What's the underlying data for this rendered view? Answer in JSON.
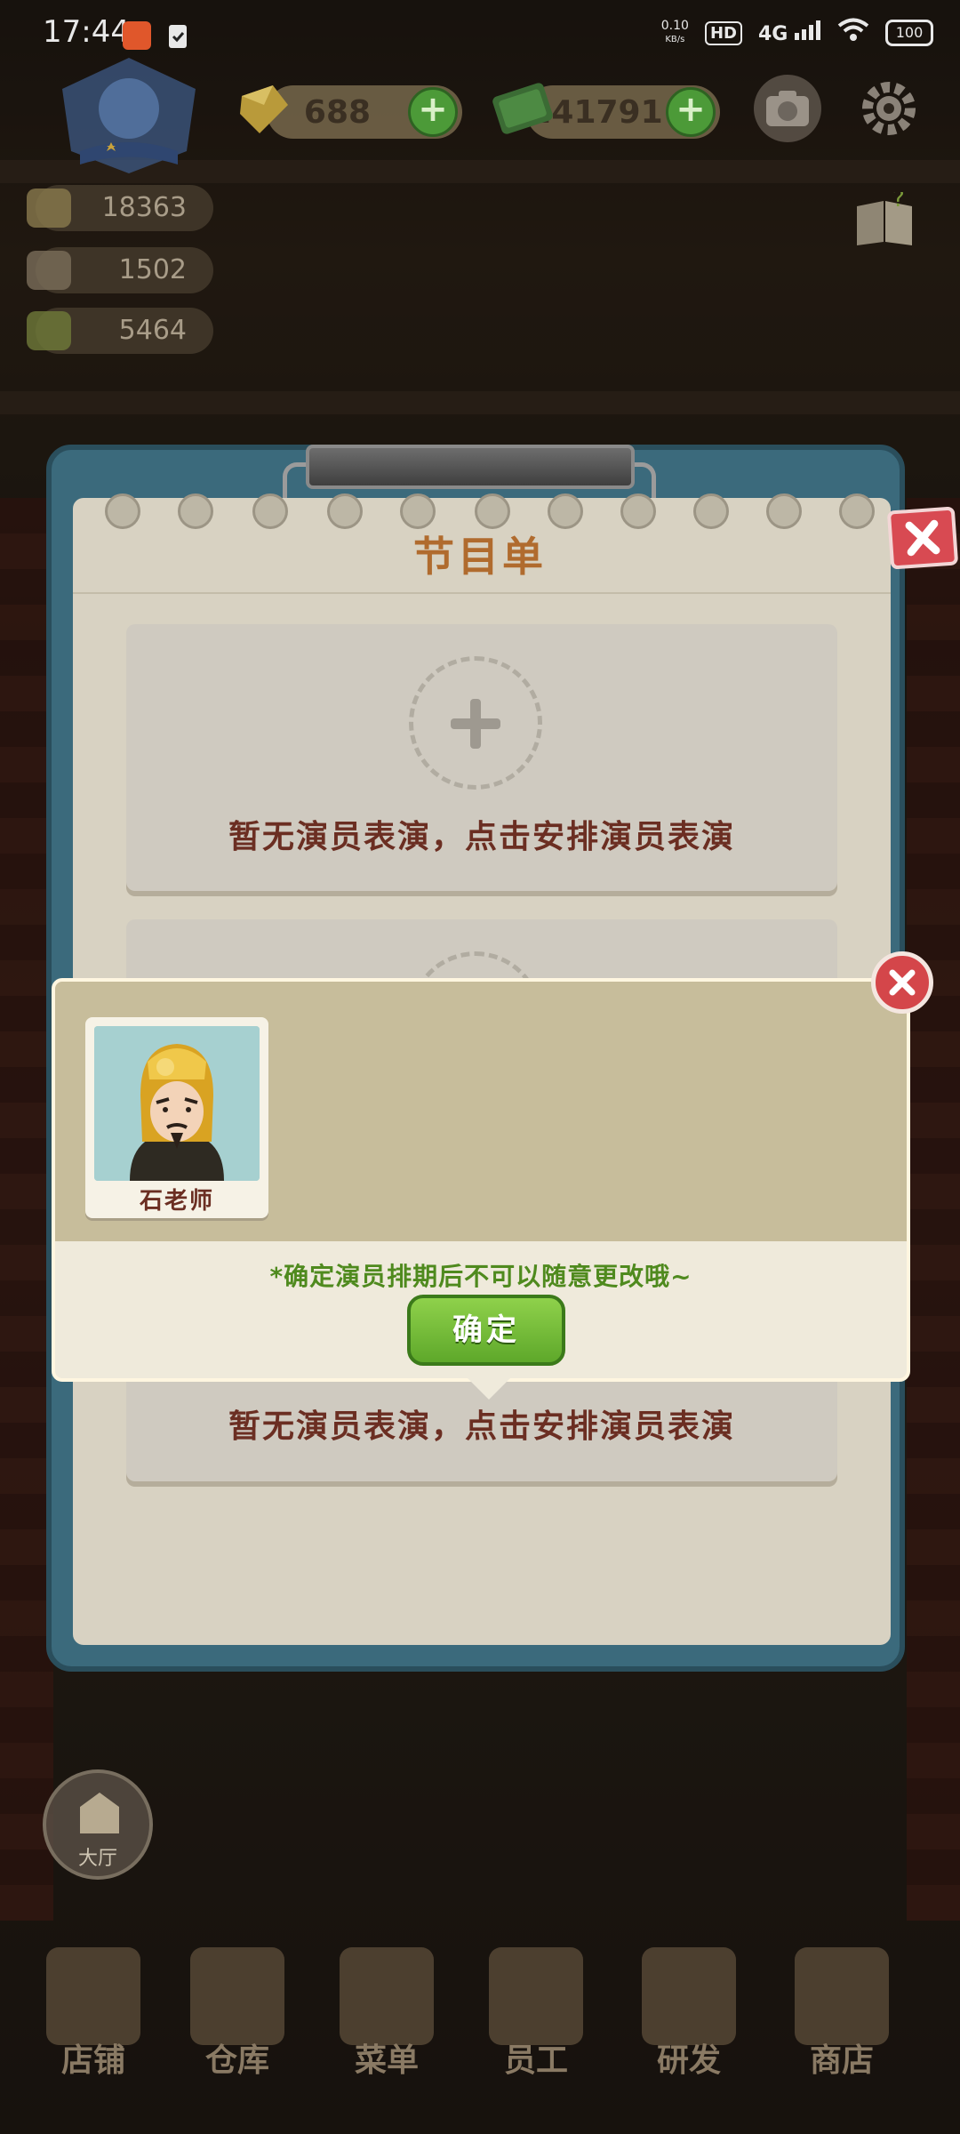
{
  "status_bar": {
    "time": "17:44",
    "net_speed_value": "0.10",
    "net_speed_unit": "KB/s",
    "hd": "HD",
    "network": "4G",
    "battery": "100"
  },
  "hud": {
    "gems": "688",
    "cash": "241791",
    "stats": [
      "18363",
      "1502",
      "5464"
    ]
  },
  "program_list": {
    "title": "节目单",
    "slot_hint": "暂无演员表演，点击安排演员表演"
  },
  "actor_popup": {
    "actor_name": "石老师",
    "notice": "*确定演员排期后不可以随意更改哦~",
    "confirm_label": "确定"
  },
  "hall_button_label": "大厅",
  "bottom_nav": [
    {
      "label": "店铺"
    },
    {
      "label": "仓库"
    },
    {
      "label": "菜单"
    },
    {
      "label": "员工"
    },
    {
      "label": "研发"
    },
    {
      "label": "商店"
    }
  ],
  "colors": {
    "panel_frame": "#3b6a7c",
    "title": "#b06b2e",
    "confirm_green": "#5ea82a",
    "close_red": "#d84a52"
  }
}
